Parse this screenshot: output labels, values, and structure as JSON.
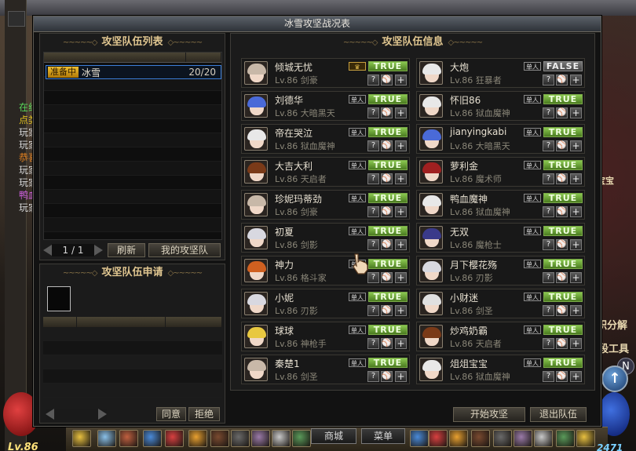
{
  "window": {
    "title": "冰雪攻坚战况表"
  },
  "background": {
    "chat_lines": [
      {
        "text": "在线",
        "color": "#5ad85a"
      },
      {
        "text": "点类",
        "color": "#e0c020"
      },
      {
        "text": "玩家",
        "color": "#d8d8d8"
      },
      {
        "text": "玩家",
        "color": "#d8d8d8"
      },
      {
        "text": "恭喜",
        "color": "#e08020"
      },
      {
        "text": "玩家",
        "color": "#d8d8d8"
      },
      {
        "text": "玩家",
        "color": "#d8d8d8"
      },
      {
        "text": "鸭血",
        "color": "#d060e0"
      },
      {
        "text": "玩家",
        "color": "#d8d8d8"
      }
    ],
    "right_texts": {
      "a": "宝宝",
      "b": "积分解",
      "c": "段工具"
    },
    "n_label": "N",
    "up_arrow": "↑",
    "level": "Lv.86",
    "hp_value": "2471",
    "hotbar": {
      "shop": "商城",
      "menu": "菜单"
    }
  },
  "left_panel": {
    "title": "攻坚队伍列表",
    "teams": [
      {
        "status": "准备中",
        "name": "冰雪",
        "count": "20/20"
      }
    ],
    "pager": {
      "page": "1 / 1"
    },
    "refresh": "刷新",
    "my_team": "我的攻坚队"
  },
  "apply_panel": {
    "title": "攻坚队伍申请",
    "agree": "同意",
    "refuse": "拒绝"
  },
  "right_panel": {
    "title": "攻坚队伍信息",
    "members": [
      {
        "name": "倾城无忧",
        "level": "Lv.86 剑豪",
        "badge": "leader",
        "status": "TRUE",
        "hair": "#c8b8a8"
      },
      {
        "name": "大炮",
        "level": "Lv.86 狂暴者",
        "badge": "单人",
        "status": "FALSE",
        "hair": "#e8e8e8"
      },
      {
        "name": "刘德华",
        "level": "Lv.86 大暗黑天",
        "badge": "单人",
        "status": "TRUE",
        "hair": "#4a6ad8"
      },
      {
        "name": "怀旧86",
        "level": "Lv.86 狱血魔神",
        "badge": "单人",
        "status": "TRUE",
        "hair": "#e8e8e8"
      },
      {
        "name": "帝在哭泣",
        "level": "Lv.86 狱血魔神",
        "badge": "单人",
        "status": "TRUE",
        "hair": "#e8e8e8"
      },
      {
        "name": "jianyingkabi",
        "level": "Lv.86 大暗黑天",
        "badge": "单人",
        "status": "TRUE",
        "hair": "#4a6ad8"
      },
      {
        "name": "大吉大利",
        "level": "Lv.86 天启者",
        "badge": "单人",
        "status": "TRUE",
        "hair": "#7a3a18"
      },
      {
        "name": "萝利金",
        "level": "Lv.86 魔术师",
        "badge": "单人",
        "status": "TRUE",
        "hair": "#a02020"
      },
      {
        "name": "珍妮玛蒂劲",
        "level": "Lv.86 剑豪",
        "badge": "单人",
        "status": "TRUE",
        "hair": "#c8b8a8"
      },
      {
        "name": "鸭血魔神",
        "level": "Lv.86 狱血魔神",
        "badge": "单人",
        "status": "TRUE",
        "hair": "#e8e8e8"
      },
      {
        "name": "初夏",
        "level": "Lv.86 剑影",
        "badge": "单人",
        "status": "TRUE",
        "hair": "#d8d8e0"
      },
      {
        "name": "无双",
        "level": "Lv.86 魔枪士",
        "badge": "单人",
        "status": "TRUE",
        "hair": "#3a3a8a"
      },
      {
        "name": "神力",
        "level": "Lv.86 格斗家",
        "badge": "单人",
        "status": "TRUE",
        "hair": "#d06020"
      },
      {
        "name": "月下樱花殇",
        "level": "Lv.86 刃影",
        "badge": "单人",
        "status": "TRUE",
        "hair": "#d8d8e0"
      },
      {
        "name": "小妮",
        "level": "Lv.86 刃影",
        "badge": "单人",
        "status": "TRUE",
        "hair": "#d8d8e0"
      },
      {
        "name": "小财迷",
        "level": "Lv.86 剑圣",
        "badge": "单人",
        "status": "TRUE",
        "hair": "#e0e0e0"
      },
      {
        "name": "球球",
        "level": "Lv.86 神枪手",
        "badge": "单人",
        "status": "TRUE",
        "hair": "#e8c840"
      },
      {
        "name": "炒鸡奶霸",
        "level": "Lv.86 天启者",
        "badge": "单人",
        "status": "TRUE",
        "hair": "#7a3a18"
      },
      {
        "name": "秦楚1",
        "level": "Lv.86 剑圣",
        "badge": "单人",
        "status": "TRUE",
        "hair": "#c8b8a8"
      },
      {
        "name": "俎俎宝宝",
        "level": "Lv.86 狱血魔神",
        "badge": "单人",
        "status": "TRUE",
        "hair": "#e8e8e8"
      }
    ],
    "start": "开始攻坚",
    "exit": "退出队伍",
    "icon_question": "?",
    "icon_plus": "+",
    "leader_icon": "crown-icon"
  }
}
